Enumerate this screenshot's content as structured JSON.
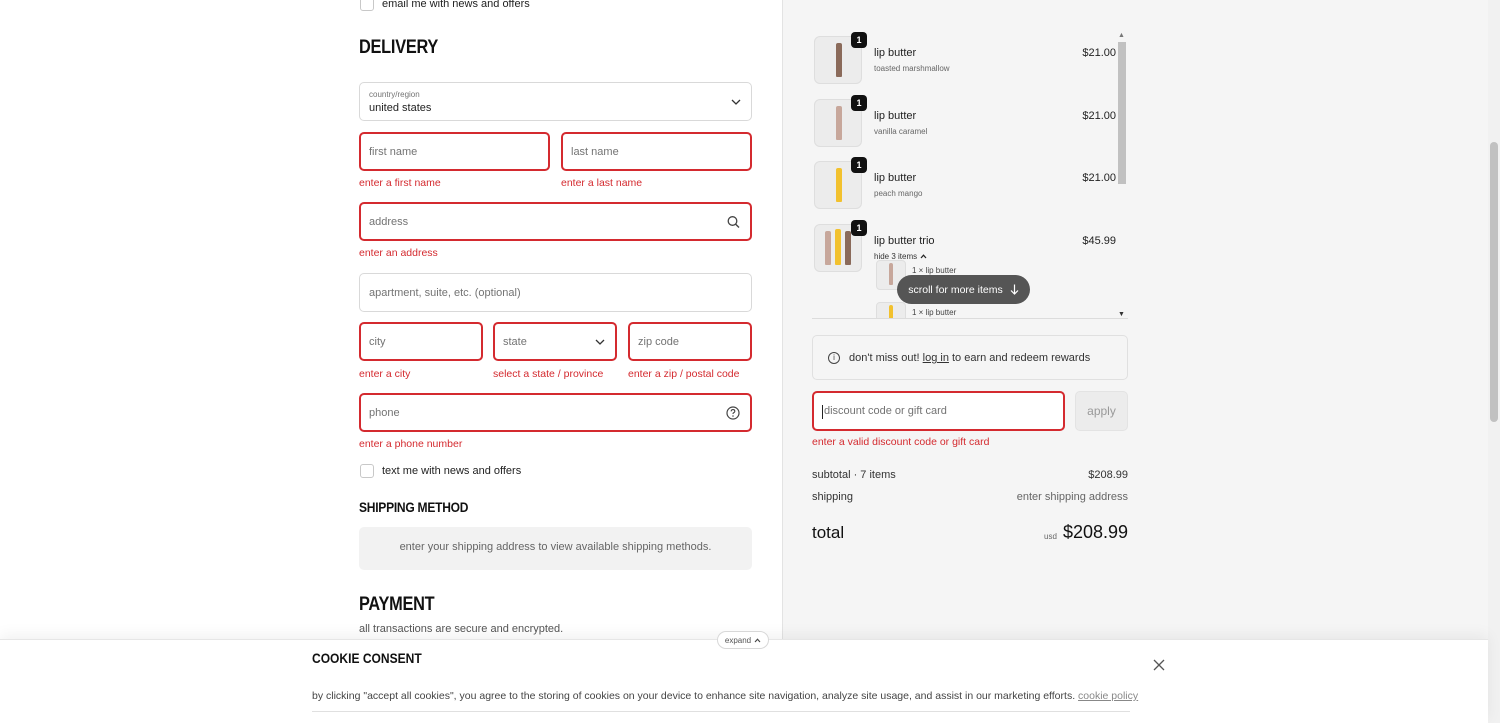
{
  "contact": {
    "email_optin_label": "email me with news and offers"
  },
  "delivery": {
    "title": "DELIVERY",
    "country": {
      "label": "country/region",
      "value": "united states"
    },
    "first_name": {
      "placeholder": "first name",
      "error": "enter a first name"
    },
    "last_name": {
      "placeholder": "last name",
      "error": "enter a last name"
    },
    "address": {
      "placeholder": "address",
      "error": "enter an address"
    },
    "apartment": {
      "placeholder": "apartment, suite, etc. (optional)"
    },
    "city": {
      "placeholder": "city",
      "error": "enter a city"
    },
    "state": {
      "placeholder": "state",
      "error": "select a state / province"
    },
    "zip": {
      "placeholder": "zip code",
      "error": "enter a zip / postal code"
    },
    "phone": {
      "placeholder": "phone",
      "error": "enter a phone number"
    },
    "text_optin_label": "text me with news and offers"
  },
  "shipping_method": {
    "title": "SHIPPING METHOD",
    "message": "enter your shipping address to view available shipping methods."
  },
  "payment": {
    "title": "PAYMENT",
    "subtitle": "all transactions are secure and encrypted."
  },
  "order": {
    "items": [
      {
        "qty": "1",
        "name": "lip butter",
        "variant": "toasted marshmallow",
        "price": "$21.00",
        "color": "#8a6a5a"
      },
      {
        "qty": "1",
        "name": "lip butter",
        "variant": "vanilla caramel",
        "price": "$21.00",
        "color": "#c7a79b"
      },
      {
        "qty": "1",
        "name": "lip butter",
        "variant": "peach mango",
        "price": "$21.00",
        "color": "#f2c12e"
      },
      {
        "qty": "1",
        "name": "lip butter trio",
        "toggle": "hide 3 items",
        "price": "$45.99"
      }
    ],
    "sub_items": [
      {
        "label": "1 × lip butter",
        "color": "#c7a79b"
      },
      {
        "label": "1 × lip butter",
        "color": "#f2c12e"
      }
    ],
    "scroll_hint": "scroll for more items",
    "rewards": {
      "prefix": "don't miss out!",
      "link": "log in",
      "suffix": "to earn and redeem rewards"
    },
    "discount": {
      "placeholder": "discount code or gift card",
      "button": "apply",
      "error": "enter a valid discount code or gift card"
    },
    "subtotal": {
      "label": "subtotal · 7 items",
      "value": "$208.99"
    },
    "shipping": {
      "label": "shipping",
      "value": "enter shipping address"
    },
    "total": {
      "label": "total",
      "currency": "usd",
      "value": "$208.99"
    }
  },
  "cookie": {
    "expand": "expand",
    "title": "COOKIE CONSENT",
    "text": "by clicking \"accept all cookies\", you agree to the storing of cookies on your device to enhance site navigation, analyze site usage, and assist in our marketing efforts.",
    "link": "cookie policy"
  },
  "colors": {
    "error": "#d42a2f",
    "summary_bg": "#f5f5f5",
    "pill_bg": "#555555"
  }
}
